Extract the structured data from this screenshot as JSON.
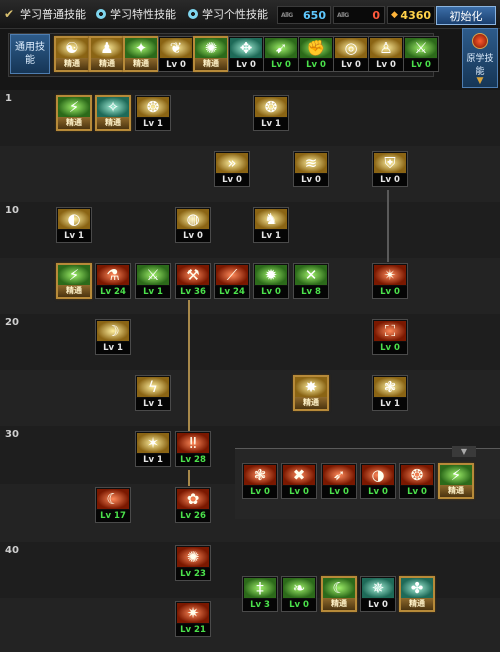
{
  "header": {
    "options": [
      {
        "label": "学习普通技能",
        "selected": true
      },
      {
        "label": "学习特性技能",
        "selected": false
      },
      {
        "label": "学习个性技能",
        "selected": false
      }
    ],
    "stats": [
      {
        "label": "AllG",
        "value": "650",
        "color": "#5ec8ff"
      },
      {
        "label": "AllG",
        "value": "0",
        "color": "#ff5a3c"
      },
      {
        "label": "◆",
        "value": "4360",
        "color": "#ffd24a"
      }
    ],
    "init_button": "初始化"
  },
  "common": {
    "label": "通用技能",
    "skills": [
      {
        "icon": "run-icon",
        "glyph": "☯",
        "tone": "gold",
        "level": "精通",
        "adv": true
      },
      {
        "icon": "man-icon",
        "glyph": "♟",
        "tone": "gold",
        "level": "精通",
        "adv": true
      },
      {
        "icon": "leap-icon",
        "glyph": "✦",
        "tone": "green",
        "level": "精通",
        "adv": true
      },
      {
        "icon": "wings-icon",
        "glyph": "❦",
        "tone": "gold",
        "level": "Lv 0",
        "adv": false
      },
      {
        "icon": "star-icon",
        "glyph": "✺",
        "tone": "green",
        "level": "精通",
        "adv": true
      },
      {
        "icon": "compass-icon",
        "glyph": "✥",
        "tone": "teal",
        "level": "Lv 0",
        "adv": false
      },
      {
        "icon": "strike-icon",
        "glyph": "➹",
        "tone": "green",
        "level": "Lv 0",
        "adv": false
      },
      {
        "icon": "punch-icon",
        "glyph": "✊",
        "tone": "green",
        "level": "Lv 0",
        "adv": false
      },
      {
        "icon": "target-icon",
        "glyph": "◎",
        "tone": "gold",
        "level": "Lv 0",
        "adv": false
      },
      {
        "icon": "figure-icon",
        "glyph": "♙",
        "tone": "gold",
        "level": "Lv 0",
        "adv": false
      },
      {
        "icon": "slash-icon",
        "glyph": "⚔",
        "tone": "green",
        "level": "Lv 0",
        "adv": false
      }
    ]
  },
  "side_button": {
    "label": "原学技能"
  },
  "tree_levels": [
    "1",
    "10",
    "20",
    "30",
    "40"
  ],
  "tree_skills": [
    {
      "icon": "claw-icon",
      "glyph": "⚡",
      "tone": "green",
      "level": "精通",
      "adv": true
    },
    {
      "icon": "aura-icon",
      "glyph": "✧",
      "tone": "teal",
      "level": "精通",
      "adv": true
    },
    {
      "icon": "swirl-icon",
      "glyph": "❂",
      "tone": "gold",
      "level": "Lv 1",
      "adv": false
    },
    {
      "icon": "swirl-icon",
      "glyph": "❂",
      "tone": "gold",
      "level": "Lv 1",
      "adv": false
    },
    {
      "icon": "dash-icon",
      "glyph": "»",
      "tone": "gold",
      "level": "Lv 0",
      "adv": false
    },
    {
      "icon": "wave-icon",
      "glyph": "≋",
      "tone": "gold",
      "level": "Lv 0",
      "adv": false
    },
    {
      "icon": "shield-icon",
      "glyph": "⛨",
      "tone": "gold",
      "level": "Lv 0",
      "adv": false
    },
    {
      "icon": "spin-icon",
      "glyph": "◐",
      "tone": "gold",
      "level": "Lv 1",
      "adv": false
    },
    {
      "icon": "vortex-icon",
      "glyph": "◍",
      "tone": "gold",
      "level": "Lv 0",
      "adv": false
    },
    {
      "icon": "warrior-icon",
      "glyph": "♞",
      "tone": "gold",
      "level": "Lv 1",
      "adv": false
    },
    {
      "icon": "green-claw-icon",
      "glyph": "⚡",
      "tone": "green",
      "level": "精通",
      "adv": true
    },
    {
      "icon": "red-potion-icon",
      "glyph": "⚗",
      "tone": "red",
      "level": "Lv 24",
      "adv": false
    },
    {
      "icon": "sword-icon",
      "glyph": "⚔",
      "tone": "green",
      "level": "Lv 1",
      "adv": false
    },
    {
      "icon": "red-hammer-icon",
      "glyph": "⚒",
      "tone": "red",
      "level": "Lv 36",
      "adv": false
    },
    {
      "icon": "red-blade-icon",
      "glyph": "⟋",
      "tone": "red",
      "level": "Lv 24",
      "adv": false
    },
    {
      "icon": "burst-icon",
      "glyph": "✹",
      "tone": "green",
      "level": "Lv 0",
      "adv": false
    },
    {
      "icon": "cross-blade-icon",
      "glyph": "✕",
      "tone": "green",
      "level": "Lv 8",
      "adv": false
    },
    {
      "icon": "flame-icon",
      "glyph": "✴",
      "tone": "red",
      "level": "Lv 0",
      "adv": false
    },
    {
      "icon": "arc-icon",
      "glyph": "☽",
      "tone": "gold",
      "level": "Lv 1",
      "adv": false
    },
    {
      "icon": "red-armor-icon",
      "glyph": "⛶",
      "tone": "red",
      "level": "Lv 0",
      "adv": false
    },
    {
      "icon": "lightning-icon",
      "glyph": "ϟ",
      "tone": "gold",
      "level": "Lv 1",
      "adv": false
    },
    {
      "icon": "explosion-icon",
      "glyph": "✸",
      "tone": "gold",
      "level": "精通",
      "adv": true
    },
    {
      "icon": "gale-icon",
      "glyph": "❃",
      "tone": "gold",
      "level": "Lv 1",
      "adv": false
    },
    {
      "icon": "flash-icon",
      "glyph": "✶",
      "tone": "gold",
      "level": "Lv 1",
      "adv": false
    },
    {
      "icon": "twin-sword-icon",
      "glyph": "‼",
      "tone": "red",
      "level": "Lv 28",
      "adv": false
    },
    {
      "icon": "crescent-icon",
      "glyph": "☾",
      "tone": "red",
      "level": "Lv 17",
      "adv": false
    },
    {
      "icon": "phoenix-icon",
      "glyph": "✿",
      "tone": "red",
      "level": "Lv 26",
      "adv": false
    },
    {
      "icon": "nova-icon",
      "glyph": "✺",
      "tone": "red",
      "level": "Lv 23",
      "adv": false
    },
    {
      "icon": "fire-burst-icon",
      "glyph": "✷",
      "tone": "red",
      "level": "Lv 21",
      "adv": false
    }
  ],
  "popup_row1": [
    {
      "icon": "wind-slash-icon",
      "glyph": "❃",
      "tone": "red",
      "level": "Lv 0",
      "adv": false
    },
    {
      "icon": "fang-icon",
      "glyph": "✖",
      "tone": "red",
      "level": "Lv 0",
      "adv": false
    },
    {
      "icon": "sweep-icon",
      "glyph": "➶",
      "tone": "red",
      "level": "Lv 0",
      "adv": false
    },
    {
      "icon": "moon-slash-icon",
      "glyph": "◑",
      "tone": "red",
      "level": "Lv 0",
      "adv": false
    },
    {
      "icon": "red-swirl-icon",
      "glyph": "❂",
      "tone": "red",
      "level": "Lv 0",
      "adv": false
    },
    {
      "icon": "mastery-slash-icon",
      "glyph": "⚡",
      "tone": "green",
      "level": "精通",
      "adv": true
    }
  ],
  "popup_row2": [
    {
      "icon": "sword-stance-icon",
      "glyph": "‡",
      "tone": "green",
      "level": "Lv 3",
      "adv": false
    },
    {
      "icon": "wing-strike-icon",
      "glyph": "❧",
      "tone": "green",
      "level": "Lv 0",
      "adv": false
    },
    {
      "icon": "crescent-moon-icon",
      "glyph": "☾",
      "tone": "green",
      "level": "精通",
      "adv": true
    },
    {
      "icon": "spark-icon",
      "glyph": "✵",
      "tone": "teal",
      "level": "Lv 0",
      "adv": false
    },
    {
      "icon": "dragon-icon",
      "glyph": "✤",
      "tone": "teal",
      "level": "精通",
      "adv": true
    }
  ]
}
